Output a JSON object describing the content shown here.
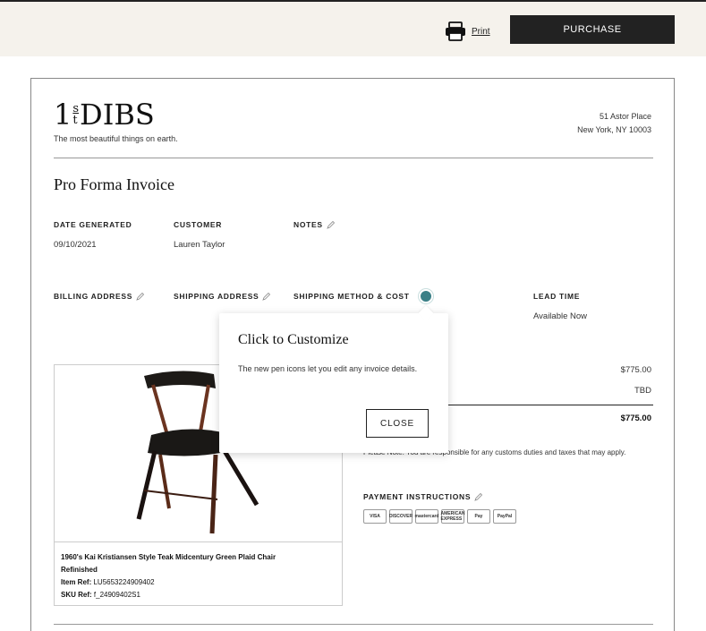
{
  "header": {
    "print_label": "Print",
    "purchase_label": "PURCHASE"
  },
  "brand": {
    "logo_one": "1",
    "logo_s": "s",
    "logo_t": "t",
    "logo_dibs": "DIBS",
    "tagline": "The most beautiful things on earth.",
    "address_line1": "51 Astor Place",
    "address_line2": "New York, NY 10003"
  },
  "invoice": {
    "title": "Pro Forma Invoice",
    "date_label": "DATE GENERATED",
    "date_value": "09/10/2021",
    "customer_label": "CUSTOMER",
    "customer_value": "Lauren Taylor",
    "notes_label": "NOTES",
    "billing_label": "BILLING ADDRESS",
    "shipping_label": "SHIPPING ADDRESS",
    "shipping_method_label": "SHIPPING METHOD & COST",
    "lead_time_label": "LEAD TIME",
    "lead_time_value": "Available Now"
  },
  "pricing": {
    "subtotal": "$775.00",
    "shipping": "TBD",
    "total": "$775.00",
    "note": "Please Note: You are responsible for any customs duties and taxes that may apply."
  },
  "payment": {
    "label": "PAYMENT INSTRUCTIONS",
    "methods": [
      "VISA",
      "DISCOVER",
      "mastercard",
      "AMERICAN EXPRESS",
      "Pay",
      "PayPal"
    ]
  },
  "product": {
    "name": "1960's Kai Kristiansen Style Teak Midcentury Green Plaid Chair",
    "condition": "Refinished",
    "item_ref_label": "Item Ref:",
    "item_ref_value": "LU5653224909402",
    "sku_ref_label": "SKU Ref:",
    "sku_ref_value": "f_24909402S1"
  },
  "popover": {
    "title": "Click to Customize",
    "body": "The new pen icons let you edit any invoice details.",
    "close_label": "CLOSE"
  }
}
